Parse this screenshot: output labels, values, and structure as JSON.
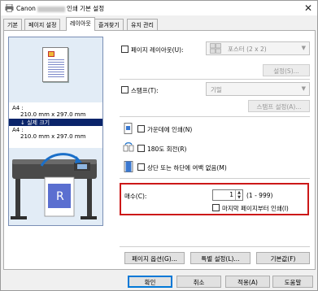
{
  "window": {
    "title_prefix": "Canon",
    "title_suffix": "인쇄 기본 설정",
    "close": "✕"
  },
  "tabs": [
    {
      "label": "기본"
    },
    {
      "label": "페이지 설정"
    },
    {
      "label": "레이아웃"
    },
    {
      "label": "즐겨찾기"
    },
    {
      "label": "유지 관리"
    }
  ],
  "active_tab": "레이아웃",
  "preview": {
    "source_size": "A4 :",
    "source_dims": "210.0 mm x 297.0 mm",
    "scale_label": "↓ 실제 크기",
    "target_size": "A4 :",
    "target_dims": "210.0 mm x 297.0 mm"
  },
  "page_layout": {
    "label": "페이지 레이아웃(U):",
    "checked": false,
    "combo_value": "포스터 (2 x 2)",
    "settings_button": "설정(S)..."
  },
  "stamp": {
    "label": "스탬프(T):",
    "checked": false,
    "combo_value": "기밀",
    "settings_button": "스탬프 설정(A)..."
  },
  "options": {
    "center_print": {
      "label": "가운데에 인쇄(N)",
      "checked": false
    },
    "rotate_180": {
      "label": "180도 회전(R)",
      "checked": false
    },
    "no_margin": {
      "label": "상단 또는 하단에 여백 없음(M)",
      "checked": false
    }
  },
  "copies": {
    "label": "매수(C):",
    "value": "1",
    "range": "(1 - 999)",
    "reverse_label": "마지막 페이지부터 인쇄(I)",
    "reverse_checked": false
  },
  "bottom_buttons": {
    "page_options": "페이지 옵션(G)...",
    "special_settings": "특별 설정(L)...",
    "defaults": "기본값(F)"
  },
  "dialog_buttons": {
    "ok": "확인",
    "cancel": "취소",
    "apply": "적용(A)",
    "help": "도움말"
  }
}
